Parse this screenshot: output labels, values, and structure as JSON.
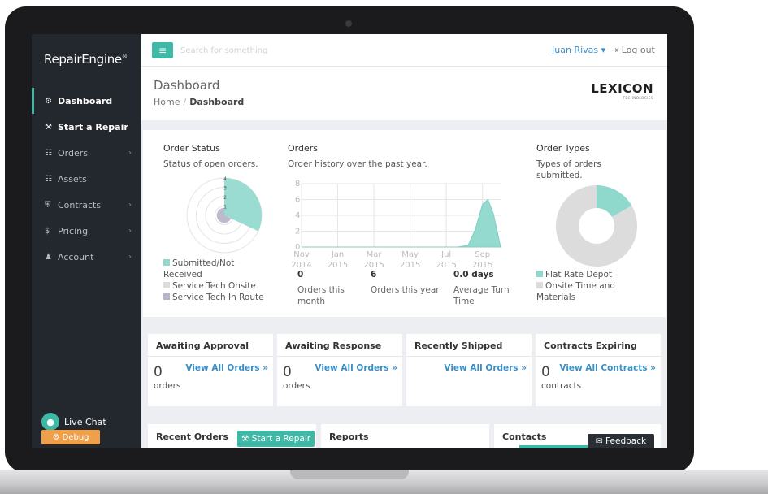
{
  "app": {
    "brand": "RepairEngine",
    "brand_mark": "®"
  },
  "colors": {
    "accent": "#3fb9a6",
    "sidebar_bg": "#23272e",
    "link": "#3a8fc9",
    "chart_gray": "#dcdcdc",
    "chart_purple": "#b6b3c8"
  },
  "sidebar": {
    "items": [
      {
        "label": "Dashboard",
        "icon": "dashboard-icon",
        "glyph": "⚙"
      },
      {
        "label": "Start a Repair",
        "icon": "wrench-icon",
        "glyph": "⚒"
      },
      {
        "label": "Orders",
        "icon": "list-icon",
        "glyph": "☷"
      },
      {
        "label": "Assets",
        "icon": "grid-icon",
        "glyph": "☷"
      },
      {
        "label": "Contracts",
        "icon": "shield-icon",
        "glyph": "⛨"
      },
      {
        "label": "Pricing",
        "icon": "dollar-icon",
        "glyph": "$"
      },
      {
        "label": "Account",
        "icon": "user-icon",
        "glyph": "♟"
      }
    ],
    "live_chat": "Live Chat",
    "debug": "⚙ Debug"
  },
  "topbar": {
    "search_placeholder": "Search for something",
    "user": "Juan Rivas ▾",
    "logout": "⇥ Log out"
  },
  "header": {
    "title": "Dashboard",
    "breadcrumb_home": "Home",
    "breadcrumb_sep": "/",
    "breadcrumb_current": "Dashboard",
    "logo": "LEXICON",
    "logo_sub": "TECHNOLOGIES"
  },
  "order_status": {
    "title": "Order Status",
    "subtitle": "Status of open orders.",
    "legend": [
      "Submitted/Not Received",
      "Service Tech Onsite",
      "Service Tech In Route"
    ]
  },
  "orders": {
    "title": "Orders",
    "subtitle": "Order history over the past year.",
    "metrics": [
      {
        "value": "0",
        "label": "Orders this month"
      },
      {
        "value": "6",
        "label": "Orders this year"
      },
      {
        "value": "0.0 days",
        "label": "Average Turn Time"
      }
    ]
  },
  "order_types": {
    "title": "Order Types",
    "subtitle": "Types of orders submitted.",
    "legend": [
      "Flat Rate Depot",
      "Onsite Time and Materials"
    ]
  },
  "widgets": [
    {
      "title": "Awaiting Approval",
      "count": "0",
      "unit": "orders",
      "link": "View All Orders »"
    },
    {
      "title": "Awaiting Response",
      "count": "0",
      "unit": "orders",
      "link": "View All Orders »"
    },
    {
      "title": "Recently Shipped",
      "count": "",
      "unit": "",
      "link": "View All Orders »"
    },
    {
      "title": "Contracts Expiring",
      "count": "0",
      "unit": "contracts",
      "link": "View All Contracts »"
    }
  ],
  "bottom": {
    "recent_orders": "Recent Orders",
    "start_repair": "⚒ Start a Repair",
    "reports": "Reports",
    "contacts": "Contacts",
    "feedback": "✉ Feedback"
  },
  "chart_data": [
    {
      "type": "pie",
      "polar": true,
      "rlim": [
        0,
        4
      ],
      "r_ticks": [
        "1",
        "2",
        "3",
        "4"
      ],
      "categories": [
        "Submitted/Not Received",
        "Service Tech Onsite",
        "Service Tech In Route"
      ],
      "values": [
        4,
        0,
        1
      ],
      "angles_deg": [
        [
          0,
          115
        ],
        [
          115,
          115
        ],
        [
          115,
          360
        ]
      ],
      "colors": [
        "#8fd8cc",
        "#dcdcdc",
        "#b6b3c8"
      ]
    },
    {
      "type": "area",
      "ylim": [
        0,
        8
      ],
      "y_ticks": [
        "0",
        "2",
        "4",
        "6",
        "8"
      ],
      "categories": [
        "Nov 2014",
        "Jan 2015",
        "Mar 2015",
        "May 2015",
        "Jul 2015",
        "Sep 2015"
      ],
      "x": [
        0,
        0.5,
        1,
        1.5,
        2,
        2.5,
        3,
        3.5,
        4,
        4.3,
        4.6,
        4.8,
        5.0,
        5.15,
        5.3,
        5.5
      ],
      "values": [
        0,
        0,
        0,
        0,
        0,
        0,
        0,
        0,
        0,
        0,
        0.2,
        2.2,
        5.4,
        6.0,
        4.2,
        0
      ],
      "grid": true,
      "color": "#8fd8cc"
    },
    {
      "type": "pie",
      "donut": true,
      "categories": [
        "Flat Rate Depot",
        "Onsite Time and Materials"
      ],
      "values": [
        1,
        5
      ],
      "colors": [
        "#8fd8cc",
        "#dcdcdc"
      ]
    }
  ]
}
